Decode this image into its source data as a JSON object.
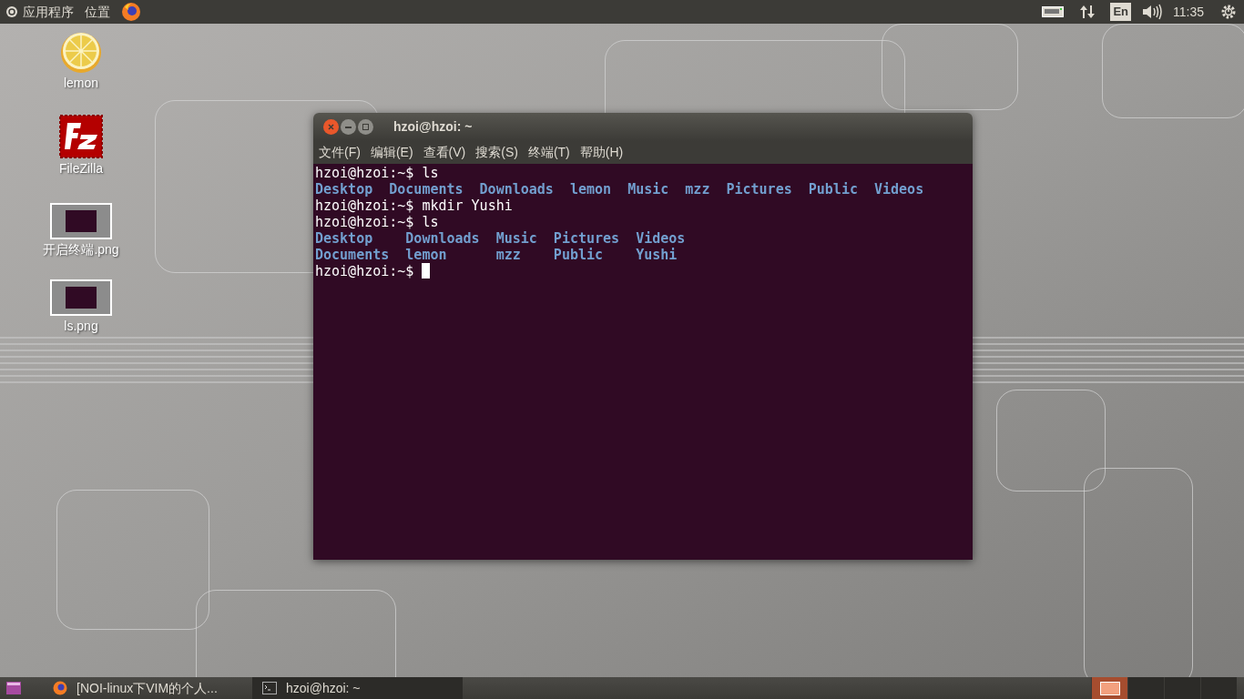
{
  "top_bar": {
    "menus": [
      "应用程序",
      "位置"
    ],
    "keyboard_layout": "En",
    "clock": "11:35"
  },
  "desktop_icons": [
    {
      "kind": "lemon",
      "label": "lemon"
    },
    {
      "kind": "filezilla",
      "label": "FileZilla"
    },
    {
      "kind": "screenshot",
      "label": "开启终端.png"
    },
    {
      "kind": "screenshot",
      "label": "ls.png"
    }
  ],
  "terminal": {
    "title": "hzoi@hzoi: ~",
    "menus": [
      "文件(F)",
      "编辑(E)",
      "查看(V)",
      "搜索(S)",
      "终端(T)",
      "帮助(H)"
    ],
    "lines": [
      {
        "kind": "prompt",
        "text": "hzoi@hzoi:~$ ls"
      },
      {
        "kind": "listing",
        "entries": [
          "Desktop",
          "Documents",
          "Downloads",
          "lemon",
          "Music",
          "mzz",
          "Pictures",
          "Public",
          "Videos"
        ]
      },
      {
        "kind": "prompt",
        "text": "hzoi@hzoi:~$ mkdir Yushi"
      },
      {
        "kind": "prompt",
        "text": "hzoi@hzoi:~$ ls"
      },
      {
        "kind": "grid",
        "rows": [
          [
            "Desktop",
            "Downloads",
            "Music",
            "Pictures",
            "Videos"
          ],
          [
            "Documents",
            "lemon",
            "mzz",
            "Public",
            "Yushi"
          ]
        ]
      },
      {
        "kind": "prompt",
        "text": "hzoi@hzoi:~$",
        "cursor": true
      }
    ]
  },
  "taskbar": {
    "tasks": [
      {
        "kind": "browser",
        "label": "[NOI-linux下VIM的个人...",
        "selected": false
      },
      {
        "kind": "terminal",
        "label": "hzoi@hzoi: ~",
        "selected": true
      }
    ],
    "workspaces": [
      {
        "selected": true
      },
      {
        "selected": false
      },
      {
        "selected": false
      },
      {
        "selected": false
      }
    ]
  }
}
